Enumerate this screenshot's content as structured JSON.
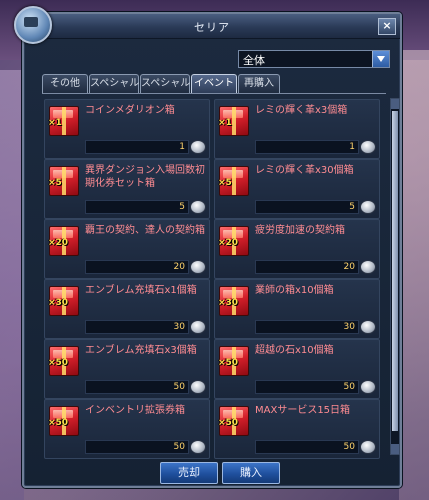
{
  "window": {
    "title": "セリア"
  },
  "filter": {
    "selected": "全体"
  },
  "tabs": [
    {
      "label": "その他"
    },
    {
      "label": "スペシャル"
    },
    {
      "label": "スペシャル"
    },
    {
      "label": "イベント"
    },
    {
      "label": "再購入"
    }
  ],
  "items": [
    {
      "name": "コインメダリオン箱",
      "qty": "×1",
      "price": "1"
    },
    {
      "name": "レミの輝く革x3個箱",
      "qty": "×1",
      "price": "1"
    },
    {
      "name": "異界ダンジョン入場回数初期化券セット箱",
      "qty": "×5",
      "price": "5"
    },
    {
      "name": "レミの輝く革x30個箱",
      "qty": "×5",
      "price": "5"
    },
    {
      "name": "覇王の契約、達人の契約箱",
      "qty": "×20",
      "price": "20"
    },
    {
      "name": "疲労度加速の契約箱",
      "qty": "×20",
      "price": "20"
    },
    {
      "name": "エンブレム充填石x1個箱",
      "qty": "×30",
      "price": "30"
    },
    {
      "name": "業師の箱x10個箱",
      "qty": "×30",
      "price": "30"
    },
    {
      "name": "エンブレム充填石x3個箱",
      "qty": "×50",
      "price": "50"
    },
    {
      "name": "超越の石x10個箱",
      "qty": "×50",
      "price": "50"
    },
    {
      "name": "インベントリ拡張券箱",
      "qty": "×50",
      "price": "50"
    },
    {
      "name": "MAXサービス15日箱",
      "qty": "×50",
      "price": "50"
    }
  ],
  "buttons": {
    "sell": "売却",
    "buy": "購入"
  },
  "colors": {
    "item_name": "#ff8c92",
    "price": "#ffd36b",
    "qty": "#ffe14a",
    "accent": "#2d5ca3"
  }
}
